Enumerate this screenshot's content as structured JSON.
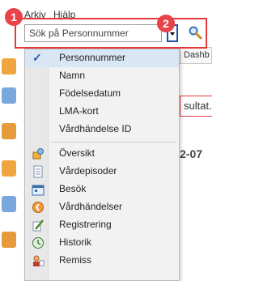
{
  "menubar": {
    "arkiv": "Arkiv",
    "hjalp": "Hjälp"
  },
  "search": {
    "placeholder": "Sök på Personnummer"
  },
  "badges": {
    "one": "1",
    "two": "2"
  },
  "background": {
    "tab": "Dashb",
    "result_text": "sultat.",
    "date_text": "2-07"
  },
  "search_type_options": [
    {
      "label": "Personnummer",
      "checked": true
    },
    {
      "label": "Namn"
    },
    {
      "label": "Födelsedatum"
    },
    {
      "label": "LMA-kort"
    },
    {
      "label": "Vårdhändelse ID"
    }
  ],
  "view_options": [
    {
      "label": "Översikt",
      "icon": "overview-icon"
    },
    {
      "label": "Vårdepisoder",
      "icon": "episodes-icon"
    },
    {
      "label": "Besök",
      "icon": "visit-icon"
    },
    {
      "label": "Vårdhändelser",
      "icon": "care-events-icon"
    },
    {
      "label": "Registrering",
      "icon": "registration-icon"
    },
    {
      "label": "Historik",
      "icon": "history-icon"
    },
    {
      "label": "Remiss",
      "icon": "referral-icon"
    }
  ],
  "colors": {
    "highlight": "#e53a3a",
    "badge": "#e8424a",
    "dropdown_border": "#1f4fa8",
    "check": "#2a5caa"
  }
}
